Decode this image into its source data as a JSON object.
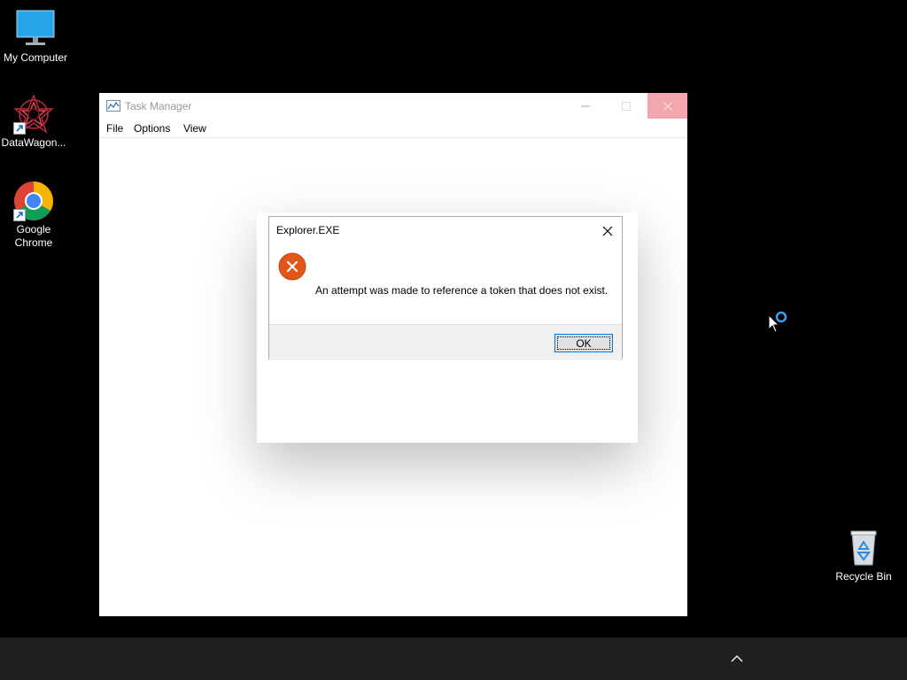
{
  "desktop": {
    "icons": [
      {
        "label": "My Computer",
        "icon": "monitor-icon"
      },
      {
        "label": "DataWagon...",
        "icon": "datawagon-logo-icon"
      },
      {
        "label": "Google Chrome",
        "icon": "chrome-icon"
      },
      {
        "label": "Recycle Bin",
        "icon": "recycle-bin-icon"
      }
    ]
  },
  "task_manager": {
    "title": "Task Manager",
    "menu": [
      "File",
      "Options",
      "View"
    ],
    "close_button_color": "#f1a7ad"
  },
  "dialog": {
    "title": "Explorer.EXE",
    "message": "An attempt was made to reference a token that does not exist.",
    "ok_label": "OK",
    "icon": "error-icon",
    "error_color": "#e2561a",
    "focus_color": "#0078d7"
  },
  "taskbar": {
    "tray_icon": "chevron-up-icon",
    "background": "#202020"
  }
}
